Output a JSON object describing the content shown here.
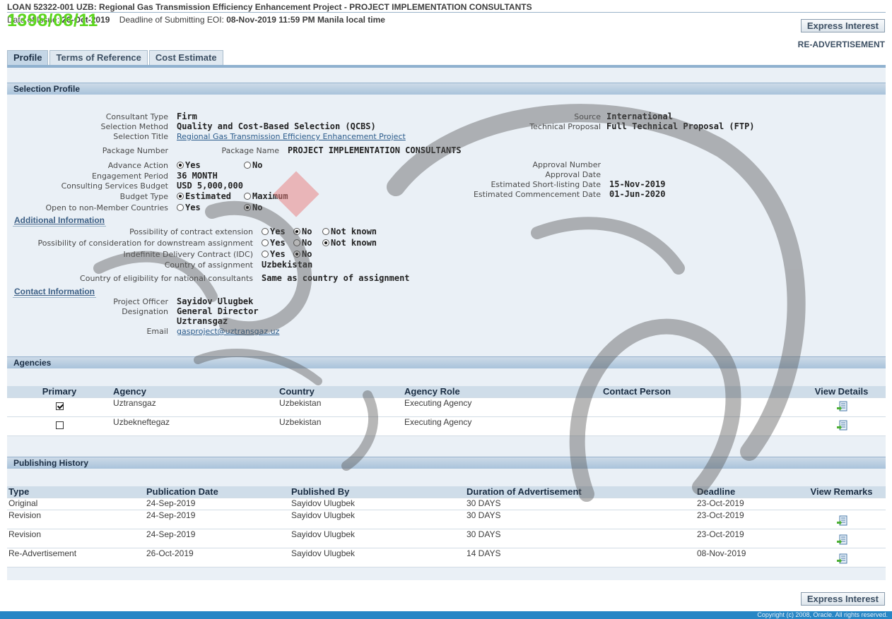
{
  "header": {
    "title": "LOAN 52322-001 UZB: Regional Gas Transmission Efficiency Enhancement Project - PROJECT IMPLEMENTATION CONSULTANTS",
    "date_label": "Date of Issue:",
    "date_value": "26-Oct-2019",
    "deadline_label": "Deadline of Submitting EOI:",
    "deadline_value": "08-Nov-2019 11:59 PM Manila local time",
    "stamp": "1398/08/11"
  },
  "actions": {
    "express_interest": "Express Interest",
    "readvertisement": "RE-ADVERTISEMENT"
  },
  "tabs": [
    {
      "label": "Profile",
      "active": true
    },
    {
      "label": "Terms of Reference",
      "active": false
    },
    {
      "label": "Cost Estimate",
      "active": false
    }
  ],
  "selection_profile": {
    "heading": "Selection Profile",
    "consultant_type": {
      "label": "Consultant Type",
      "value": "Firm"
    },
    "selection_method": {
      "label": "Selection Method",
      "value": "Quality and Cost-Based Selection (QCBS)"
    },
    "selection_title": {
      "label": "Selection Title",
      "value": "Regional Gas Transmission Efficiency Enhancement Project"
    },
    "package_number": {
      "label": "Package Number",
      "value": ""
    },
    "package_name": {
      "label": "Package Name",
      "value": "PROJECT IMPLEMENTATION CONSULTANTS"
    },
    "advance_action": {
      "label": "Advance Action",
      "options": [
        "Yes",
        "No"
      ],
      "selected": "Yes"
    },
    "engagement_period": {
      "label": "Engagement Period",
      "value": "36 MONTH"
    },
    "budget": {
      "label": "Consulting Services Budget",
      "value": "USD 5,000,000"
    },
    "budget_type": {
      "label": "Budget Type",
      "options": [
        "Estimated",
        "Maximum"
      ],
      "selected": "Estimated"
    },
    "non_member": {
      "label": "Open to non-Member Countries",
      "options": [
        "Yes",
        "No"
      ],
      "selected": "No"
    },
    "source": {
      "label": "Source",
      "value": "International"
    },
    "technical_proposal": {
      "label": "Technical Proposal",
      "value": "Full Technical Proposal (FTP)"
    },
    "approval_number": {
      "label": "Approval Number",
      "value": ""
    },
    "approval_date": {
      "label": "Approval Date",
      "value": ""
    },
    "shortlisting_date": {
      "label": "Estimated Short-listing Date",
      "value": "15-Nov-2019"
    },
    "commencement_date": {
      "label": "Estimated Commencement Date",
      "value": "01-Jun-2020"
    }
  },
  "additional_info": {
    "heading": "Additional Information",
    "contract_extension": {
      "label": "Possibility of contract extension",
      "options": [
        "Yes",
        "No",
        "Not known"
      ],
      "selected": "No"
    },
    "downstream": {
      "label": "Possibility of consideration for downstream assignment",
      "options": [
        "Yes",
        "No",
        "Not known"
      ],
      "selected": "Not known"
    },
    "idc": {
      "label": "Indefinite Delivery Contract (IDC)",
      "options": [
        "Yes",
        "No"
      ],
      "selected": "No"
    },
    "country": {
      "label": "Country of assignment",
      "value": "Uzbekistan"
    },
    "eligibility": {
      "label": "Country of eligibility for national consultants",
      "value": "Same as country of assignment"
    }
  },
  "contact_info": {
    "heading": "Contact Information",
    "officer": {
      "label": "Project Officer",
      "value": "Sayidov Ulugbek"
    },
    "designation": {
      "label": "Designation",
      "value": "General Director",
      "value2": "Uztransgaz"
    },
    "email": {
      "label": "Email",
      "value": "gasproject@uztransgaz.uz"
    }
  },
  "agencies": {
    "heading": "Agencies",
    "columns": [
      "Primary",
      "Agency",
      "Country",
      "Agency Role",
      "Contact Person",
      "View Details"
    ],
    "rows": [
      {
        "primary": true,
        "agency": "Uztransgaz",
        "country": "Uzbekistan",
        "role": "Executing Agency",
        "contact": ""
      },
      {
        "primary": false,
        "agency": "Uzbekneftegaz",
        "country": "Uzbekistan",
        "role": "Executing Agency",
        "contact": ""
      }
    ]
  },
  "publishing": {
    "heading": "Publishing History",
    "columns": [
      "Type",
      "Publication Date",
      "Published By",
      "Duration of Advertisement",
      "Deadline",
      "View Remarks"
    ],
    "rows": [
      {
        "type": "Original",
        "date": "24-Sep-2019",
        "by": "Sayidov Ulugbek",
        "duration": "30 DAYS",
        "deadline": "23-Oct-2019",
        "icon": false
      },
      {
        "type": "Revision",
        "date": "24-Sep-2019",
        "by": "Sayidov Ulugbek",
        "duration": "30 DAYS",
        "deadline": "23-Oct-2019",
        "icon": true
      },
      {
        "type": "Revision",
        "date": "24-Sep-2019",
        "by": "Sayidov Ulugbek",
        "duration": "30 DAYS",
        "deadline": "23-Oct-2019",
        "icon": true
      },
      {
        "type": "Re-Advertisement",
        "date": "26-Oct-2019",
        "by": "Sayidov Ulugbek",
        "duration": "14 DAYS",
        "deadline": "08-Nov-2019",
        "icon": true
      }
    ]
  },
  "footer": {
    "copyright": "Copyright (c) 2008, Oracle. All rights reserved."
  },
  "colors": {
    "footer": "#2786c5",
    "section": "#a9c3db",
    "stamp": "#5cd61e",
    "panel": "#eaf0f6"
  }
}
